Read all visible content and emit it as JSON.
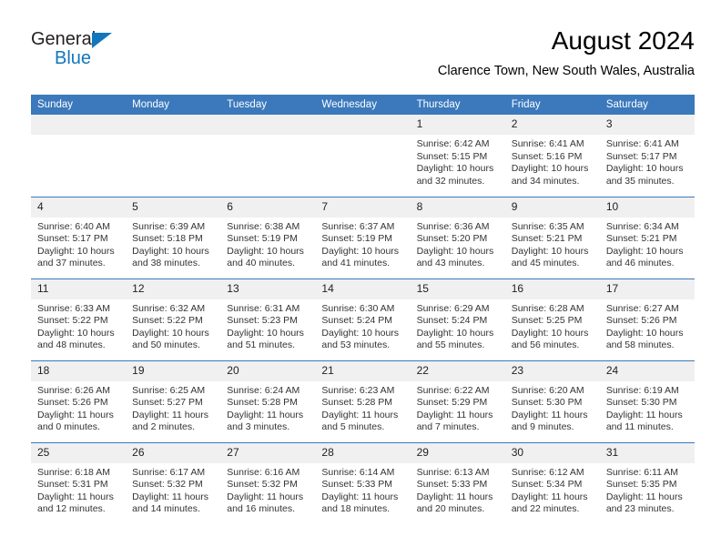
{
  "brand": {
    "name_top": "General",
    "name_bottom": "Blue",
    "triangle_color": "#1176bc",
    "text_color": "#231f20"
  },
  "header": {
    "title": "August 2024",
    "location": "Clarence Town, New South Wales, Australia"
  },
  "theme": {
    "header_blue": "#3b79bc",
    "daynum_grey": "#f0f0f0",
    "body_text": "#333333",
    "page_background": "#ffffff"
  },
  "calendar": {
    "weekday_headers": [
      "Sunday",
      "Monday",
      "Tuesday",
      "Wednesday",
      "Thursday",
      "Friday",
      "Saturday"
    ],
    "weeks": [
      [
        {
          "day": "",
          "sunrise": "",
          "sunset": "",
          "daylight_1": "",
          "daylight_2": ""
        },
        {
          "day": "",
          "sunrise": "",
          "sunset": "",
          "daylight_1": "",
          "daylight_2": ""
        },
        {
          "day": "",
          "sunrise": "",
          "sunset": "",
          "daylight_1": "",
          "daylight_2": ""
        },
        {
          "day": "",
          "sunrise": "",
          "sunset": "",
          "daylight_1": "",
          "daylight_2": ""
        },
        {
          "day": "1",
          "sunrise": "Sunrise: 6:42 AM",
          "sunset": "Sunset: 5:15 PM",
          "daylight_1": "Daylight: 10 hours",
          "daylight_2": "and 32 minutes."
        },
        {
          "day": "2",
          "sunrise": "Sunrise: 6:41 AM",
          "sunset": "Sunset: 5:16 PM",
          "daylight_1": "Daylight: 10 hours",
          "daylight_2": "and 34 minutes."
        },
        {
          "day": "3",
          "sunrise": "Sunrise: 6:41 AM",
          "sunset": "Sunset: 5:17 PM",
          "daylight_1": "Daylight: 10 hours",
          "daylight_2": "and 35 minutes."
        }
      ],
      [
        {
          "day": "4",
          "sunrise": "Sunrise: 6:40 AM",
          "sunset": "Sunset: 5:17 PM",
          "daylight_1": "Daylight: 10 hours",
          "daylight_2": "and 37 minutes."
        },
        {
          "day": "5",
          "sunrise": "Sunrise: 6:39 AM",
          "sunset": "Sunset: 5:18 PM",
          "daylight_1": "Daylight: 10 hours",
          "daylight_2": "and 38 minutes."
        },
        {
          "day": "6",
          "sunrise": "Sunrise: 6:38 AM",
          "sunset": "Sunset: 5:19 PM",
          "daylight_1": "Daylight: 10 hours",
          "daylight_2": "and 40 minutes."
        },
        {
          "day": "7",
          "sunrise": "Sunrise: 6:37 AM",
          "sunset": "Sunset: 5:19 PM",
          "daylight_1": "Daylight: 10 hours",
          "daylight_2": "and 41 minutes."
        },
        {
          "day": "8",
          "sunrise": "Sunrise: 6:36 AM",
          "sunset": "Sunset: 5:20 PM",
          "daylight_1": "Daylight: 10 hours",
          "daylight_2": "and 43 minutes."
        },
        {
          "day": "9",
          "sunrise": "Sunrise: 6:35 AM",
          "sunset": "Sunset: 5:21 PM",
          "daylight_1": "Daylight: 10 hours",
          "daylight_2": "and 45 minutes."
        },
        {
          "day": "10",
          "sunrise": "Sunrise: 6:34 AM",
          "sunset": "Sunset: 5:21 PM",
          "daylight_1": "Daylight: 10 hours",
          "daylight_2": "and 46 minutes."
        }
      ],
      [
        {
          "day": "11",
          "sunrise": "Sunrise: 6:33 AM",
          "sunset": "Sunset: 5:22 PM",
          "daylight_1": "Daylight: 10 hours",
          "daylight_2": "and 48 minutes."
        },
        {
          "day": "12",
          "sunrise": "Sunrise: 6:32 AM",
          "sunset": "Sunset: 5:22 PM",
          "daylight_1": "Daylight: 10 hours",
          "daylight_2": "and 50 minutes."
        },
        {
          "day": "13",
          "sunrise": "Sunrise: 6:31 AM",
          "sunset": "Sunset: 5:23 PM",
          "daylight_1": "Daylight: 10 hours",
          "daylight_2": "and 51 minutes."
        },
        {
          "day": "14",
          "sunrise": "Sunrise: 6:30 AM",
          "sunset": "Sunset: 5:24 PM",
          "daylight_1": "Daylight: 10 hours",
          "daylight_2": "and 53 minutes."
        },
        {
          "day": "15",
          "sunrise": "Sunrise: 6:29 AM",
          "sunset": "Sunset: 5:24 PM",
          "daylight_1": "Daylight: 10 hours",
          "daylight_2": "and 55 minutes."
        },
        {
          "day": "16",
          "sunrise": "Sunrise: 6:28 AM",
          "sunset": "Sunset: 5:25 PM",
          "daylight_1": "Daylight: 10 hours",
          "daylight_2": "and 56 minutes."
        },
        {
          "day": "17",
          "sunrise": "Sunrise: 6:27 AM",
          "sunset": "Sunset: 5:26 PM",
          "daylight_1": "Daylight: 10 hours",
          "daylight_2": "and 58 minutes."
        }
      ],
      [
        {
          "day": "18",
          "sunrise": "Sunrise: 6:26 AM",
          "sunset": "Sunset: 5:26 PM",
          "daylight_1": "Daylight: 11 hours",
          "daylight_2": "and 0 minutes."
        },
        {
          "day": "19",
          "sunrise": "Sunrise: 6:25 AM",
          "sunset": "Sunset: 5:27 PM",
          "daylight_1": "Daylight: 11 hours",
          "daylight_2": "and 2 minutes."
        },
        {
          "day": "20",
          "sunrise": "Sunrise: 6:24 AM",
          "sunset": "Sunset: 5:28 PM",
          "daylight_1": "Daylight: 11 hours",
          "daylight_2": "and 3 minutes."
        },
        {
          "day": "21",
          "sunrise": "Sunrise: 6:23 AM",
          "sunset": "Sunset: 5:28 PM",
          "daylight_1": "Daylight: 11 hours",
          "daylight_2": "and 5 minutes."
        },
        {
          "day": "22",
          "sunrise": "Sunrise: 6:22 AM",
          "sunset": "Sunset: 5:29 PM",
          "daylight_1": "Daylight: 11 hours",
          "daylight_2": "and 7 minutes."
        },
        {
          "day": "23",
          "sunrise": "Sunrise: 6:20 AM",
          "sunset": "Sunset: 5:30 PM",
          "daylight_1": "Daylight: 11 hours",
          "daylight_2": "and 9 minutes."
        },
        {
          "day": "24",
          "sunrise": "Sunrise: 6:19 AM",
          "sunset": "Sunset: 5:30 PM",
          "daylight_1": "Daylight: 11 hours",
          "daylight_2": "and 11 minutes."
        }
      ],
      [
        {
          "day": "25",
          "sunrise": "Sunrise: 6:18 AM",
          "sunset": "Sunset: 5:31 PM",
          "daylight_1": "Daylight: 11 hours",
          "daylight_2": "and 12 minutes."
        },
        {
          "day": "26",
          "sunrise": "Sunrise: 6:17 AM",
          "sunset": "Sunset: 5:32 PM",
          "daylight_1": "Daylight: 11 hours",
          "daylight_2": "and 14 minutes."
        },
        {
          "day": "27",
          "sunrise": "Sunrise: 6:16 AM",
          "sunset": "Sunset: 5:32 PM",
          "daylight_1": "Daylight: 11 hours",
          "daylight_2": "and 16 minutes."
        },
        {
          "day": "28",
          "sunrise": "Sunrise: 6:14 AM",
          "sunset": "Sunset: 5:33 PM",
          "daylight_1": "Daylight: 11 hours",
          "daylight_2": "and 18 minutes."
        },
        {
          "day": "29",
          "sunrise": "Sunrise: 6:13 AM",
          "sunset": "Sunset: 5:33 PM",
          "daylight_1": "Daylight: 11 hours",
          "daylight_2": "and 20 minutes."
        },
        {
          "day": "30",
          "sunrise": "Sunrise: 6:12 AM",
          "sunset": "Sunset: 5:34 PM",
          "daylight_1": "Daylight: 11 hours",
          "daylight_2": "and 22 minutes."
        },
        {
          "day": "31",
          "sunrise": "Sunrise: 6:11 AM",
          "sunset": "Sunset: 5:35 PM",
          "daylight_1": "Daylight: 11 hours",
          "daylight_2": "and 23 minutes."
        }
      ]
    ]
  }
}
